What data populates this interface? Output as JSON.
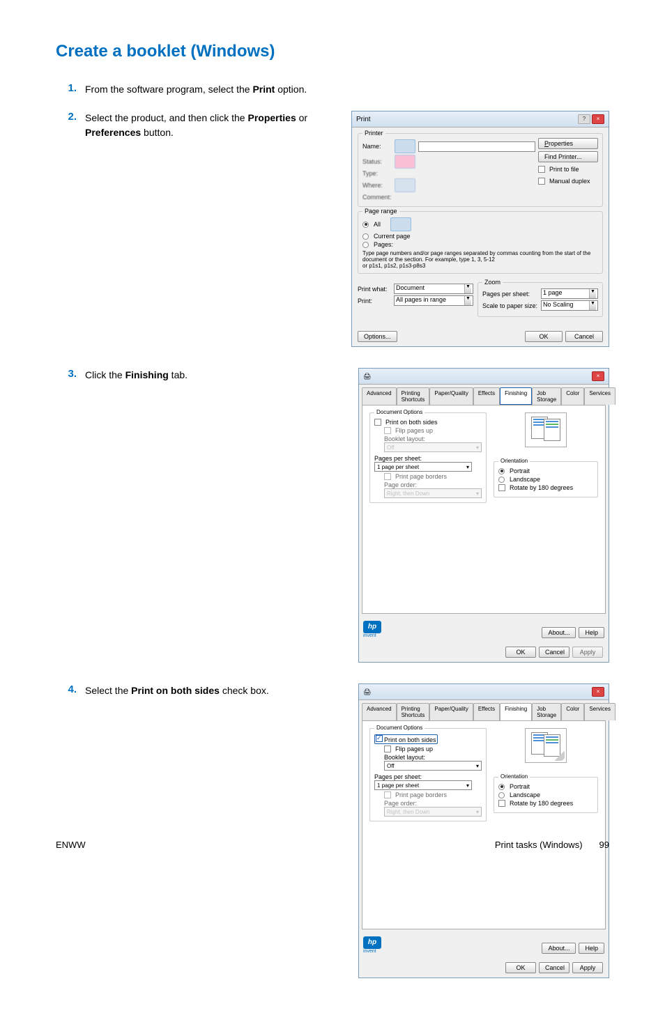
{
  "title": "Create a booklet (Windows)",
  "steps": {
    "s1": {
      "num": "1.",
      "t1": "From the software program, select the ",
      "b1": "Print",
      "t2": " option."
    },
    "s2": {
      "num": "2.",
      "t1": "Select the product, and then click the ",
      "b1": "Properties",
      "t2": " or ",
      "b2": "Preferences",
      "t3": " button."
    },
    "s3": {
      "num": "3.",
      "t1": "Click the ",
      "b1": "Finishing",
      "t2": " tab."
    },
    "s4": {
      "num": "4.",
      "t1": "Select the ",
      "b1": "Print on both sides",
      "t2": " check box."
    }
  },
  "print_dialog": {
    "title": "Print",
    "printer_group": "Printer",
    "name_lbl": "Name:",
    "status_lbl": "Status:",
    "type_lbl": "Type:",
    "where_lbl": "Where:",
    "comment_lbl": "Comment:",
    "properties_btn": "Properties",
    "find_printer_btn": "Find Printer...",
    "print_to_file_lbl": "Print to file",
    "manual_duplex_lbl": "Manual duplex",
    "page_range_group": "Page range",
    "all_radio": "All",
    "current_radio": "Current page",
    "pages_radio": "Pages:",
    "page_range_help1": "Type page numbers and/or page ranges separated by commas counting from the start of the document or the section. For example, type 1, 3, 5-12",
    "page_range_help2": "or p1s1, p1s2, p1s3-p8s3",
    "print_what_lbl": "Print what:",
    "print_what_val": "Document",
    "print_lbl": "Print:",
    "print_val": "All pages in range",
    "zoom_group": "Zoom",
    "pps_lbl": "Pages per sheet:",
    "pps_val": "1 page",
    "scale_lbl": "Scale to paper size:",
    "scale_val": "No Scaling",
    "options_btn": "Options...",
    "ok_btn": "OK",
    "cancel_btn": "Cancel"
  },
  "props_dialog": {
    "tabs": {
      "advanced": "Advanced",
      "shortcuts": "Printing Shortcuts",
      "paper": "Paper/Quality",
      "effects": "Effects",
      "finishing": "Finishing",
      "job_storage": "Job Storage",
      "color": "Color",
      "services": "Services"
    },
    "doc_options_lbl": "Document Options",
    "print_both_sides_lbl": "Print on both sides",
    "flip_pages_lbl": "Flip pages up",
    "booklet_layout_lbl": "Booklet layout:",
    "booklet_off": "Off",
    "pages_per_sheet_lbl": "Pages per sheet:",
    "pages_per_sheet_val": "1 page per sheet",
    "print_page_borders_lbl": "Print page borders",
    "page_order_lbl": "Page order:",
    "page_order_val": "Right, then Down",
    "orientation_lbl": "Orientation",
    "portrait_lbl": "Portrait",
    "landscape_lbl": "Landscape",
    "rotate_lbl": "Rotate by 180 degrees",
    "invent_lbl": "invent",
    "about_btn": "About...",
    "help_btn": "Help",
    "ok_btn": "OK",
    "cancel_btn": "Cancel",
    "apply_btn": "Apply"
  },
  "footer": {
    "left": "ENWW",
    "right_text": "Print tasks (Windows)",
    "page_num": "99"
  }
}
